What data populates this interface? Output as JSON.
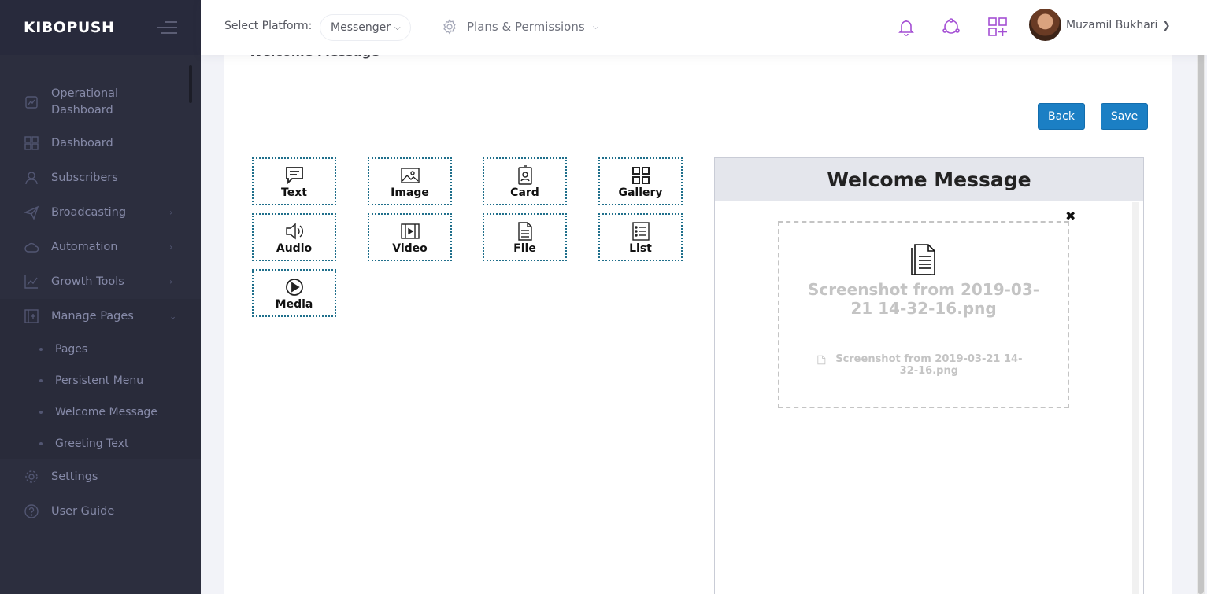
{
  "brand": "KIBOPUSH",
  "sidebar": {
    "items": [
      {
        "label": "Operational Dashboard",
        "icon": "chart-icon"
      },
      {
        "label": "Dashboard",
        "icon": "grid-icon"
      },
      {
        "label": "Subscribers",
        "icon": "user-icon"
      },
      {
        "label": "Broadcasting",
        "icon": "paper-plane-icon"
      },
      {
        "label": "Automation",
        "icon": "cloud-icon"
      },
      {
        "label": "Growth Tools",
        "icon": "line-chart-icon"
      },
      {
        "label": "Manage Pages",
        "icon": "add-page-icon"
      },
      {
        "label": "Settings",
        "icon": "gear-icon"
      },
      {
        "label": "User Guide",
        "icon": "question-icon"
      }
    ],
    "submenu": [
      "Pages",
      "Persistent Menu",
      "Welcome Message",
      "Greeting Text"
    ]
  },
  "header": {
    "platform_label": "Select Platform:",
    "platform_value": "Messenger",
    "plans_label": "Plans & Permissions",
    "user_name": "Muzamil Bukhari"
  },
  "portlet": {
    "title": "Welcome Message"
  },
  "buttons": {
    "back": "Back",
    "save": "Save"
  },
  "components": [
    "Text",
    "Image",
    "Card",
    "Gallery",
    "Audio",
    "Video",
    "File",
    "List",
    "Media"
  ],
  "preview": {
    "title": "Welcome Message",
    "file_name_large": "Screenshot from 2019-03-21 14-32-16.png",
    "file_name_small": "Screenshot from 2019-03-21 14-32-16.png"
  },
  "colors": {
    "sidebar_bg": "#2c2e3e",
    "accent_button": "#1b7fc4",
    "icon_accent": "#a44fd4"
  }
}
